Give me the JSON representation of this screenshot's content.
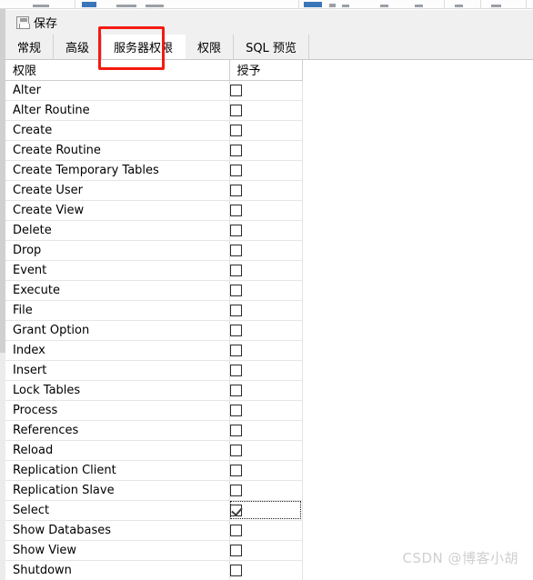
{
  "toolbar": {
    "name": "cut-off-toolbar"
  },
  "command_bar": {
    "save_label": "保存",
    "save_icon": "floppy-disk-icon"
  },
  "tabs": [
    {
      "label": "常规",
      "active": false
    },
    {
      "label": "高级",
      "active": false
    },
    {
      "label": "服务器权限",
      "active": true
    },
    {
      "label": "权限",
      "active": false
    },
    {
      "label": "SQL 预览",
      "active": false
    }
  ],
  "annotation": {
    "shape": "rectangle",
    "color": "#f51a11",
    "targets_tab": "服务器权限"
  },
  "grid": {
    "columns": [
      {
        "key": "privilege",
        "label": "权限"
      },
      {
        "key": "grant",
        "label": "授予"
      }
    ],
    "rows": [
      {
        "privilege": "Alter",
        "granted": false,
        "selected": false
      },
      {
        "privilege": "Alter Routine",
        "granted": false,
        "selected": false
      },
      {
        "privilege": "Create",
        "granted": false,
        "selected": false
      },
      {
        "privilege": "Create Routine",
        "granted": false,
        "selected": false
      },
      {
        "privilege": "Create Temporary Tables",
        "granted": false,
        "selected": false
      },
      {
        "privilege": "Create User",
        "granted": false,
        "selected": false
      },
      {
        "privilege": "Create View",
        "granted": false,
        "selected": false
      },
      {
        "privilege": "Delete",
        "granted": false,
        "selected": false
      },
      {
        "privilege": "Drop",
        "granted": false,
        "selected": false
      },
      {
        "privilege": "Event",
        "granted": false,
        "selected": false
      },
      {
        "privilege": "Execute",
        "granted": false,
        "selected": false
      },
      {
        "privilege": "File",
        "granted": false,
        "selected": false
      },
      {
        "privilege": "Grant Option",
        "granted": false,
        "selected": false
      },
      {
        "privilege": "Index",
        "granted": false,
        "selected": false
      },
      {
        "privilege": "Insert",
        "granted": false,
        "selected": false
      },
      {
        "privilege": "Lock Tables",
        "granted": false,
        "selected": false
      },
      {
        "privilege": "Process",
        "granted": false,
        "selected": false
      },
      {
        "privilege": "References",
        "granted": false,
        "selected": false
      },
      {
        "privilege": "Reload",
        "granted": false,
        "selected": false
      },
      {
        "privilege": "Replication Client",
        "granted": false,
        "selected": false
      },
      {
        "privilege": "Replication Slave",
        "granted": false,
        "selected": false
      },
      {
        "privilege": "Select",
        "granted": true,
        "selected": true
      },
      {
        "privilege": "Show Databases",
        "granted": false,
        "selected": false
      },
      {
        "privilege": "Show View",
        "granted": false,
        "selected": false
      },
      {
        "privilege": "Shutdown",
        "granted": false,
        "selected": false
      }
    ],
    "selection_color": "#0b7ad4"
  },
  "watermark": {
    "text": "CSDN @博客小胡"
  }
}
